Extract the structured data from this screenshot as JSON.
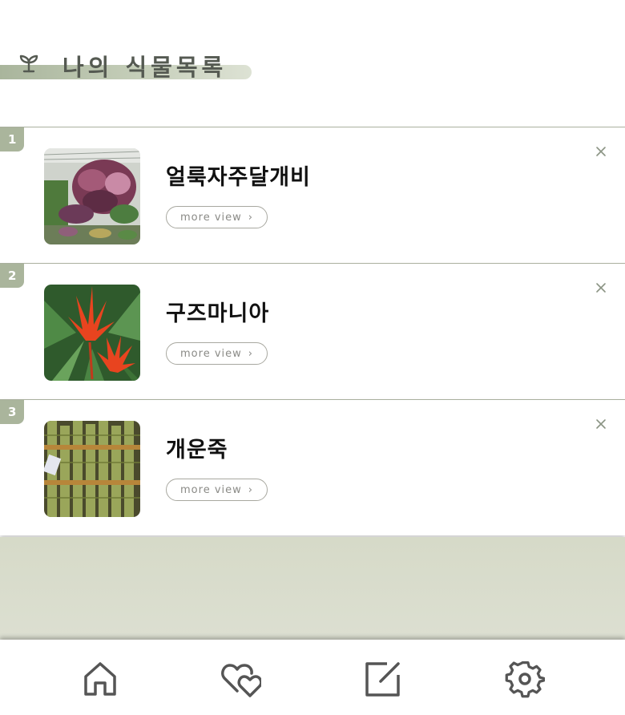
{
  "header": {
    "title": "나의 식물목록",
    "icon": "sprout-icon"
  },
  "plants": [
    {
      "index": "1",
      "name": "얼룩자주달개비",
      "more_label": "more view"
    },
    {
      "index": "2",
      "name": "구즈마니아",
      "more_label": "more view"
    },
    {
      "index": "3",
      "name": "개운죽",
      "more_label": "more view"
    }
  ],
  "nav": {
    "items": [
      {
        "name": "home",
        "icon": "home-icon"
      },
      {
        "name": "favorites",
        "icon": "hearts-icon"
      },
      {
        "name": "write",
        "icon": "edit-icon"
      },
      {
        "name": "settings",
        "icon": "gear-icon"
      }
    ]
  },
  "colors": {
    "accent": "#aab59c",
    "title": "#555a52",
    "empty_area": "#d9dccc",
    "icon": "#555555"
  }
}
